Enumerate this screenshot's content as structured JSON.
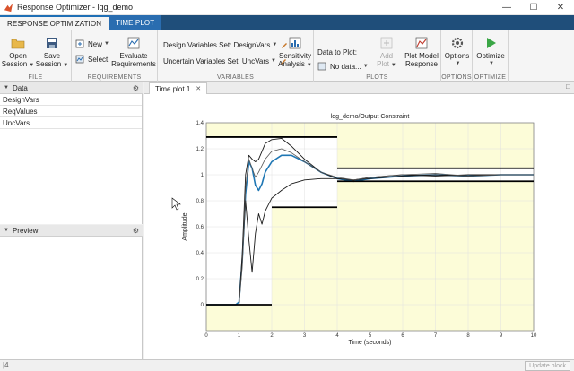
{
  "window": {
    "title": "Response Optimizer - lqg_demo"
  },
  "tabs": [
    {
      "label": "RESPONSE OPTIMIZATION"
    },
    {
      "label": "TIME PLOT"
    }
  ],
  "toolstrip": {
    "file": {
      "label": "FILE",
      "open_line1": "Open",
      "open_line2": "Session",
      "save_line1": "Save",
      "save_line2": "Session"
    },
    "requirements": {
      "label": "REQUIREMENTS",
      "new": "New",
      "select": "Select",
      "evaluate_line1": "Evaluate",
      "evaluate_line2": "Requirements"
    },
    "variables": {
      "label": "VARIABLES",
      "design_vars": "Design Variables Set: DesignVars",
      "uncertain_vars": "Uncertain Variables Set: UncVars",
      "sensitivity_line1": "Sensitivity",
      "sensitivity_line2": "Analysis"
    },
    "plots": {
      "label": "PLOTS",
      "data_to_plot": "Data to Plot:",
      "no_data": "No data...",
      "add_plot": "Add Plot",
      "plot_model_line1": "Plot Model",
      "plot_model_line2": "Response"
    },
    "options": {
      "label": "OPTIONS",
      "button": "Options"
    },
    "optimize": {
      "label": "OPTIMIZE",
      "button": "Optimize"
    }
  },
  "data_panel": {
    "title": "Data",
    "items": [
      "DesignVars",
      "ReqValues",
      "UncVars"
    ]
  },
  "preview_panel": {
    "title": "Preview"
  },
  "document": {
    "tab": "Time plot 1"
  },
  "status": {
    "left": "|4",
    "update_block": "Update block"
  },
  "colors": {
    "ribbon": "#1f4e7a",
    "constraint_fill": "#fcfcd8",
    "response_blue": "#1f77b4"
  },
  "chart_data": {
    "type": "line",
    "title": "lqg_demo/Output  Constraint",
    "xlabel": "Time (seconds)",
    "ylabel": "Amplitude",
    "xlim": [
      0,
      10
    ],
    "ylim": [
      -0.2,
      1.4
    ],
    "x_ticks": [
      "0",
      "1",
      "2",
      "3",
      "4",
      "5",
      "6",
      "7",
      "8",
      "9",
      "10"
    ],
    "y_ticks": [
      "0",
      "0.2",
      "0.4",
      "0.6",
      "0.8",
      "1",
      "1.2",
      "1.4"
    ],
    "grid": true,
    "constraint_upper": [
      {
        "x": [
          0,
          4
        ],
        "y": 1.29
      },
      {
        "x": [
          4,
          10
        ],
        "y": 1.05
      }
    ],
    "constraint_lower": [
      {
        "x": [
          0,
          2
        ],
        "y": 0
      },
      {
        "x": [
          2,
          4
        ],
        "y": 0.75
      },
      {
        "x": [
          4,
          10
        ],
        "y": 0.95
      }
    ],
    "series": [
      {
        "color": "#1f77b4",
        "width": 1.6,
        "x": [
          0,
          0.9,
          1.0,
          1.1,
          1.2,
          1.3,
          1.4,
          1.5,
          1.6,
          1.7,
          1.8,
          2.0,
          2.3,
          2.6,
          3.0,
          3.5,
          4.0,
          4.5,
          5,
          6,
          7,
          8,
          9,
          10
        ],
        "y": [
          0,
          0,
          0.02,
          0.35,
          0.85,
          1.1,
          1.05,
          0.92,
          0.88,
          0.93,
          1.02,
          1.1,
          1.15,
          1.15,
          1.1,
          1.02,
          0.97,
          0.95,
          0.97,
          0.99,
          1.0,
          0.99,
          1.0,
          1.0
        ]
      },
      {
        "color": "#1a1a1a",
        "width": 0.9,
        "x": [
          0,
          1.0,
          1.1,
          1.2,
          1.3,
          1.4,
          1.5,
          1.6,
          1.7,
          1.8,
          2.0,
          2.3,
          2.6,
          3.0,
          3.5,
          4.0,
          4.5,
          5,
          6,
          7,
          8,
          9,
          10
        ],
        "y": [
          0,
          0,
          0.4,
          1.0,
          1.15,
          1.12,
          1.1,
          1.12,
          1.18,
          1.24,
          1.27,
          1.28,
          1.22,
          1.12,
          1.02,
          0.97,
          0.96,
          0.98,
          1.0,
          0.99,
          1.0,
          1.0,
          1.0
        ]
      },
      {
        "color": "#1a1a1a",
        "width": 0.9,
        "x": [
          0,
          1.0,
          1.1,
          1.2,
          1.3,
          1.4,
          1.5,
          1.6,
          1.7,
          1.8,
          2.0,
          2.3,
          2.6,
          3.0,
          3.5,
          4.0,
          4.5,
          5,
          6,
          7,
          8,
          9,
          10
        ],
        "y": [
          0,
          0,
          0.35,
          0.8,
          0.5,
          0.25,
          0.55,
          0.7,
          0.62,
          0.72,
          0.82,
          0.88,
          0.93,
          0.96,
          0.97,
          0.97,
          0.96,
          0.97,
          0.99,
          1.0,
          0.99,
          1.0,
          1.0
        ]
      },
      {
        "color": "#555555",
        "width": 0.8,
        "x": [
          0,
          1.0,
          1.1,
          1.2,
          1.3,
          1.4,
          1.5,
          1.6,
          1.8,
          2.0,
          2.3,
          2.6,
          3.0,
          3.5,
          4.0,
          4.5,
          5,
          6,
          7,
          8,
          9,
          10
        ],
        "y": [
          0,
          0,
          0.3,
          0.9,
          1.12,
          1.05,
          0.98,
          1.02,
          1.12,
          1.18,
          1.2,
          1.17,
          1.1,
          1.02,
          0.98,
          0.96,
          0.98,
          1.0,
          1.01,
          0.99,
          1.0,
          1.0
        ]
      }
    ]
  }
}
